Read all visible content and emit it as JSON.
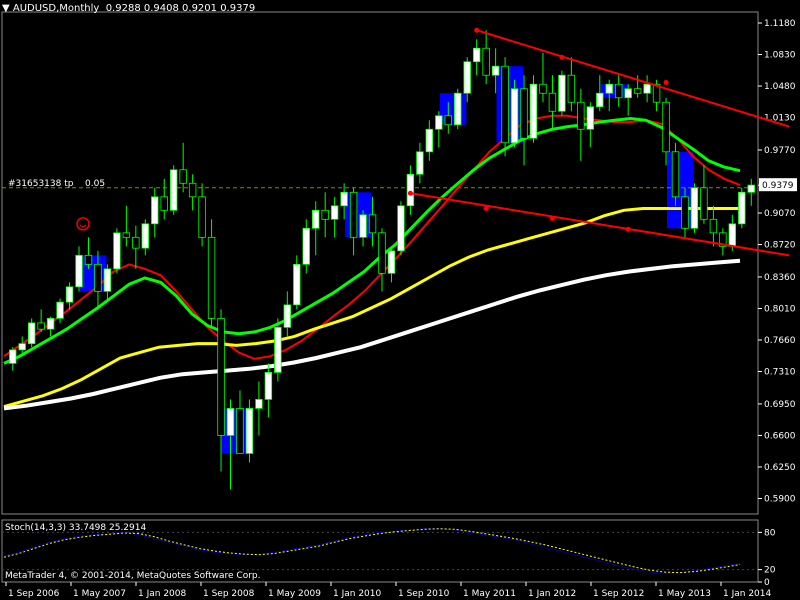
{
  "header": {
    "symbol_label": "AUDUSD,Monthly",
    "ohlc": "0.9288 0.9408 0.9201 0.9379"
  },
  "trade_label": "#31653138 tp",
  "trade_value": "0.05",
  "price_tag": "0.9379",
  "stoch_label": "Stoch(14,3,3) 33.7498 25.2914",
  "copyright": "MetaTrader 4, © 2001-2014, MetaQuotes Software Corp.",
  "colors": {
    "background": "#000000",
    "bull_candle": "#ffffff",
    "bear_candle": "#000000",
    "wick": "#00ff00",
    "ma_fast": "#ff0000",
    "ma_mid": "#00ff00",
    "ma_slow": "#ffff00",
    "ma_long": "#ffffff",
    "ma_thin": "#0000cc",
    "channel": "#ff0000",
    "highlight": "#0000ff",
    "stoch_main": "#000099",
    "stoch_signal": "#ffff00",
    "trade_line": "#888800"
  },
  "chart_data": {
    "type": "candlestick",
    "title": "AUDUSD,Monthly",
    "price_axis_ticks": [
      "1.1180",
      "1.0830",
      "1.0480",
      "1.0130",
      "0.9770",
      "0.9379",
      "0.9070",
      "0.8720",
      "0.8360",
      "0.8010",
      "0.7660",
      "0.7310",
      "0.6950",
      "0.6600",
      "0.6250",
      "0.5900"
    ],
    "ylim": [
      0.575,
      1.128
    ],
    "x_tick_labels": [
      "1 Sep 2006",
      "1 May 2007",
      "1 Jan 2008",
      "1 Sep 2008",
      "1 May 2009",
      "1 Jan 2010",
      "1 Sep 2010",
      "1 May 2011",
      "1 Jan 2012",
      "1 Sep 2012",
      "1 May 2013",
      "1 Jan 2014"
    ],
    "candles": [
      [
        0.74,
        0.758,
        0.732,
        0.755
      ],
      [
        0.755,
        0.77,
        0.748,
        0.762
      ],
      [
        0.762,
        0.79,
        0.758,
        0.785
      ],
      [
        0.785,
        0.8,
        0.775,
        0.778
      ],
      [
        0.778,
        0.792,
        0.77,
        0.79
      ],
      [
        0.79,
        0.812,
        0.785,
        0.808
      ],
      [
        0.808,
        0.83,
        0.8,
        0.825
      ],
      [
        0.825,
        0.87,
        0.82,
        0.86
      ],
      [
        0.86,
        0.88,
        0.845,
        0.85
      ],
      [
        0.85,
        0.865,
        0.8,
        0.82
      ],
      [
        0.82,
        0.85,
        0.81,
        0.845
      ],
      [
        0.845,
        0.89,
        0.84,
        0.885
      ],
      [
        0.885,
        0.915,
        0.87,
        0.88
      ],
      [
        0.88,
        0.893,
        0.845,
        0.868
      ],
      [
        0.868,
        0.9,
        0.86,
        0.895
      ],
      [
        0.895,
        0.935,
        0.88,
        0.925
      ],
      [
        0.925,
        0.945,
        0.9,
        0.91
      ],
      [
        0.91,
        0.96,
        0.905,
        0.955
      ],
      [
        0.955,
        0.985,
        0.93,
        0.94
      ],
      [
        0.94,
        0.95,
        0.91,
        0.925
      ],
      [
        0.925,
        0.94,
        0.87,
        0.88
      ],
      [
        0.88,
        0.9,
        0.78,
        0.79
      ],
      [
        0.79,
        0.8,
        0.62,
        0.66
      ],
      [
        0.66,
        0.7,
        0.6,
        0.69
      ],
      [
        0.69,
        0.71,
        0.64,
        0.64
      ],
      [
        0.64,
        0.7,
        0.63,
        0.69
      ],
      [
        0.69,
        0.72,
        0.66,
        0.7
      ],
      [
        0.7,
        0.74,
        0.68,
        0.73
      ],
      [
        0.73,
        0.79,
        0.72,
        0.78
      ],
      [
        0.78,
        0.82,
        0.77,
        0.805
      ],
      [
        0.805,
        0.86,
        0.8,
        0.85
      ],
      [
        0.85,
        0.9,
        0.84,
        0.89
      ],
      [
        0.89,
        0.92,
        0.86,
        0.91
      ],
      [
        0.91,
        0.93,
        0.88,
        0.9
      ],
      [
        0.9,
        0.925,
        0.88,
        0.915
      ],
      [
        0.915,
        0.94,
        0.9,
        0.93
      ],
      [
        0.93,
        0.935,
        0.86,
        0.88
      ],
      [
        0.88,
        0.91,
        0.87,
        0.905
      ],
      [
        0.905,
        0.925,
        0.87,
        0.885
      ],
      [
        0.885,
        0.89,
        0.82,
        0.84
      ],
      [
        0.84,
        0.87,
        0.83,
        0.865
      ],
      [
        0.865,
        0.92,
        0.86,
        0.915
      ],
      [
        0.915,
        0.96,
        0.905,
        0.95
      ],
      [
        0.95,
        0.985,
        0.94,
        0.975
      ],
      [
        0.975,
        1.01,
        0.965,
        1.0
      ],
      [
        1.0,
        1.02,
        0.98,
        1.015
      ],
      [
        1.015,
        1.03,
        0.995,
        1.005
      ],
      [
        1.005,
        1.045,
        1.0,
        1.04
      ],
      [
        1.04,
        1.08,
        1.03,
        1.075
      ],
      [
        1.075,
        1.1,
        1.06,
        1.09
      ],
      [
        1.09,
        1.11,
        1.05,
        1.06
      ],
      [
        1.06,
        1.09,
        1.04,
        1.07
      ],
      [
        1.07,
        1.08,
        0.97,
        0.985
      ],
      [
        0.985,
        1.055,
        0.98,
        1.045
      ],
      [
        1.045,
        1.06,
        0.96,
        0.99
      ],
      [
        0.99,
        1.06,
        0.985,
        1.05
      ],
      [
        1.05,
        1.085,
        1.03,
        1.04
      ],
      [
        1.04,
        1.06,
        1.0,
        1.02
      ],
      [
        1.02,
        1.065,
        1.015,
        1.06
      ],
      [
        1.06,
        1.08,
        1.02,
        1.03
      ],
      [
        1.03,
        1.045,
        0.965,
        1.0
      ],
      [
        1.0,
        1.03,
        0.98,
        1.025
      ],
      [
        1.025,
        1.06,
        1.02,
        1.04
      ],
      [
        1.04,
        1.055,
        1.02,
        1.05
      ],
      [
        1.05,
        1.06,
        1.025,
        1.035
      ],
      [
        1.035,
        1.05,
        1.015,
        1.045
      ],
      [
        1.045,
        1.06,
        1.035,
        1.04
      ],
      [
        1.04,
        1.06,
        1.03,
        1.05
      ],
      [
        1.05,
        1.055,
        1.02,
        1.03
      ],
      [
        1.03,
        1.035,
        0.96,
        0.975
      ],
      [
        0.975,
        0.985,
        0.915,
        0.925
      ],
      [
        0.925,
        0.935,
        0.88,
        0.89
      ],
      [
        0.89,
        0.94,
        0.885,
        0.935
      ],
      [
        0.935,
        0.96,
        0.895,
        0.9
      ],
      [
        0.9,
        0.915,
        0.87,
        0.885
      ],
      [
        0.885,
        0.89,
        0.86,
        0.87
      ],
      [
        0.87,
        0.905,
        0.865,
        0.895
      ],
      [
        0.895,
        0.935,
        0.89,
        0.93
      ],
      [
        0.93,
        0.945,
        0.915,
        0.938
      ]
    ],
    "highlight_bars": [
      {
        "from": 8,
        "to": 9
      },
      {
        "from": 23,
        "to": 24
      },
      {
        "from": 36,
        "to": 37
      },
      {
        "from": 46,
        "to": 47
      },
      {
        "from": 52,
        "to": 53
      },
      {
        "from": 63,
        "to": 64
      },
      {
        "from": 70,
        "to": 71
      }
    ],
    "series": [
      {
        "values": [
          0.748,
          0.76,
          0.772,
          0.785,
          0.798,
          0.812,
          0.826,
          0.842,
          0.85,
          0.845,
          0.838,
          0.82,
          0.8,
          0.78,
          0.765,
          0.752,
          0.745,
          0.748,
          0.755,
          0.765,
          0.778,
          0.792,
          0.805,
          0.82,
          0.838,
          0.856,
          0.875,
          0.895,
          0.915,
          0.935,
          0.955,
          0.975,
          0.99,
          1.005,
          1.012,
          1.015,
          1.015,
          1.012,
          1.01,
          1.008,
          1.008,
          1.01,
          1.006,
          0.99,
          0.97,
          0.955,
          0.945,
          0.938
        ]
      },
      {
        "values": [
          0.74,
          0.748,
          0.758,
          0.768,
          0.778,
          0.79,
          0.802,
          0.815,
          0.828,
          0.835,
          0.83,
          0.815,
          0.795,
          0.782,
          0.775,
          0.773,
          0.775,
          0.78,
          0.788,
          0.798,
          0.808,
          0.818,
          0.83,
          0.842,
          0.858,
          0.872,
          0.89,
          0.908,
          0.925,
          0.94,
          0.955,
          0.968,
          0.978,
          0.988,
          0.995,
          1.0,
          1.003,
          1.005,
          1.008,
          1.01,
          1.012,
          1.01,
          1.002,
          0.99,
          0.978,
          0.965,
          0.958,
          0.954
        ]
      },
      {
        "values": [
          0.692,
          0.698,
          0.704,
          0.712,
          0.722,
          0.734,
          0.746,
          0.752,
          0.758,
          0.76,
          0.762,
          0.762,
          0.76,
          0.762,
          0.765,
          0.77,
          0.778,
          0.785,
          0.792,
          0.802,
          0.812,
          0.824,
          0.836,
          0.848,
          0.858,
          0.866,
          0.872,
          0.878,
          0.884,
          0.89,
          0.896,
          0.904,
          0.91,
          0.912,
          0.912,
          0.912,
          0.912,
          0.912,
          0.912
        ]
      },
      {
        "values": [
          0.69,
          0.693,
          0.697,
          0.701,
          0.706,
          0.712,
          0.718,
          0.724,
          0.728,
          0.73,
          0.732,
          0.734,
          0.737,
          0.741,
          0.746,
          0.752,
          0.758,
          0.766,
          0.774,
          0.782,
          0.79,
          0.798,
          0.806,
          0.814,
          0.821,
          0.827,
          0.833,
          0.838,
          0.842,
          0.845,
          0.848,
          0.85,
          0.852,
          0.854
        ]
      }
    ],
    "channel_lines": [
      {
        "from": [
          49,
          1.11
        ],
        "to": [
          82,
          1.003
        ]
      },
      {
        "from": [
          42,
          0.929
        ],
        "to": [
          82,
          0.86
        ]
      }
    ],
    "channel_points": [
      {
        "line": 0,
        "points": [
          [
            49,
            1.11
          ],
          [
            58,
            1.08
          ],
          [
            69,
            1.052
          ]
        ]
      },
      {
        "line": 1,
        "points": [
          [
            42,
            0.929
          ],
          [
            50,
            0.912
          ],
          [
            57,
            0.901
          ],
          [
            65,
            0.889
          ]
        ]
      }
    ],
    "trade_level": 0.935,
    "stoch": {
      "ylim": [
        0,
        100
      ],
      "ticks": [
        "80",
        "20",
        "0"
      ],
      "main": [
        42,
        48,
        56,
        64,
        70,
        74,
        76,
        78,
        80,
        76,
        70,
        64,
        58,
        52,
        48,
        46,
        44,
        45,
        48,
        52,
        56,
        60,
        66,
        72,
        76,
        80,
        82,
        84,
        86,
        86,
        84,
        80,
        76,
        72,
        68,
        62,
        56,
        50,
        44,
        38,
        32,
        26,
        20,
        16,
        14,
        15,
        18,
        22,
        26,
        30
      ],
      "signal": [
        40,
        46,
        54,
        62,
        68,
        72,
        75,
        77,
        79,
        78,
        73,
        66,
        60,
        54,
        50,
        47,
        45,
        44,
        46,
        50,
        54,
        58,
        64,
        70,
        74,
        78,
        81,
        83,
        85,
        86,
        85,
        82,
        78,
        74,
        70,
        65,
        60,
        54,
        48,
        42,
        36,
        30,
        24,
        19,
        16,
        15,
        17,
        20,
        24,
        28
      ]
    }
  }
}
